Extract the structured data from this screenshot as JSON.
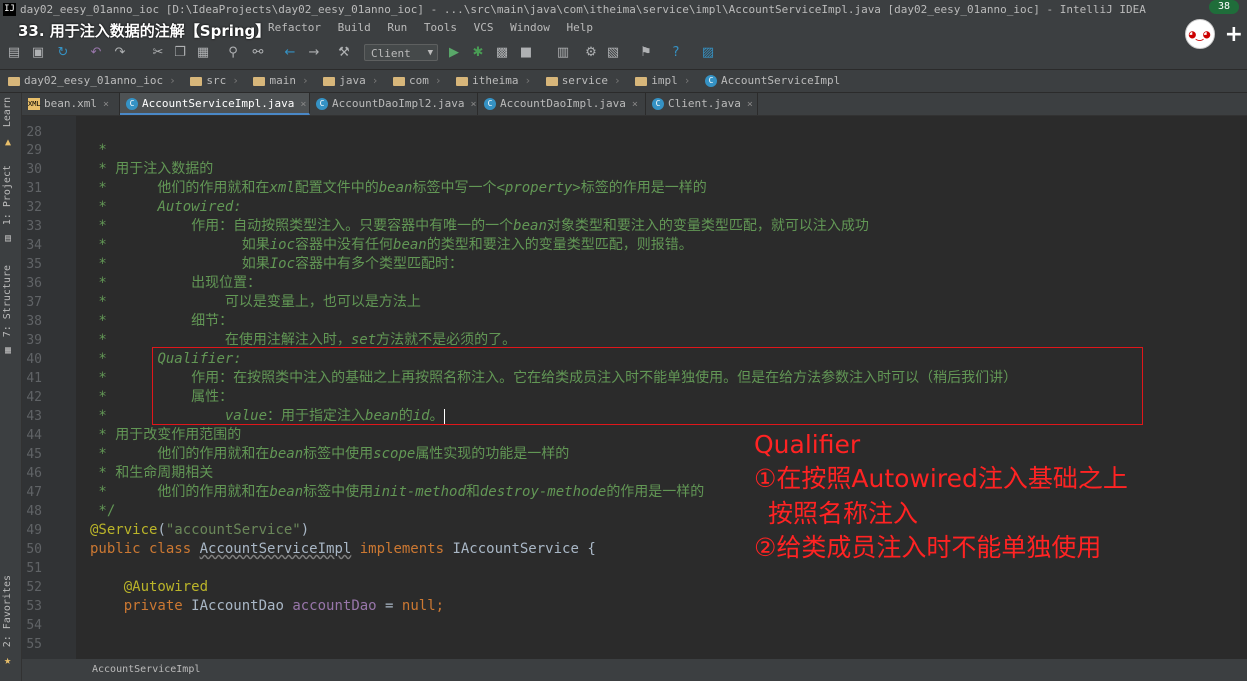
{
  "window": {
    "title": "day02_eesy_01anno_ioc [D:\\IdeaProjects\\day02_eesy_01anno_ioc] - ...\\src\\main\\java\\com\\itheima\\service\\impl\\AccountServiceImpl.java [day02_eesy_01anno_ioc] - IntelliJ IDEA"
  },
  "video_overlay": {
    "title": "33. 用于注入数据的注解【Spring】",
    "plus_label": "+",
    "counter": "38"
  },
  "menu": [
    "Refactor",
    "Build",
    "Run",
    "Tools",
    "VCS",
    "Window",
    "Help"
  ],
  "toolbar": {
    "run_config": "Client"
  },
  "breadcrumb": [
    "day02_eesy_01anno_ioc",
    "src",
    "main",
    "java",
    "com",
    "itheima",
    "service",
    "impl",
    "AccountServiceImpl"
  ],
  "tabs": [
    {
      "label": "bean.xml",
      "type": "xml",
      "active": false
    },
    {
      "label": "AccountServiceImpl.java",
      "type": "class",
      "active": true
    },
    {
      "label": "AccountDaoImpl2.java",
      "type": "class",
      "active": false
    },
    {
      "label": "AccountDaoImpl.java",
      "type": "class",
      "active": false
    },
    {
      "label": "Client.java",
      "type": "class",
      "active": false
    }
  ],
  "side_panels": [
    "1: Project",
    "2: Favorites",
    "7: Structure",
    "Learn"
  ],
  "code": {
    "line_numbers": [
      "28",
      "29",
      "30",
      "31",
      "32",
      "33",
      "34",
      "35",
      "36",
      "37",
      "38",
      "39",
      "40",
      "41",
      "42",
      "43",
      "44",
      "45",
      "46",
      "47",
      "48",
      "49",
      "50",
      "51",
      "52",
      "53",
      "54",
      "55"
    ],
    "l29": " *",
    "l30_a": " * ",
    "l30_b": "用于注入数据的",
    "l31_a": " *      他们的作用就和在",
    "l31_b": "xml",
    "l31_c": "配置文件中的",
    "l31_d": "bean",
    "l31_e": "标签中写一个",
    "l31_f": "<property>",
    "l31_g": "标签的作用是一样的",
    "l32_a": " *      ",
    "l32_b": "Autowired:",
    "l33_a": " *          作用：自动按照类型注入。只要容器中有唯一的一个",
    "l33_b": "bean",
    "l33_c": "对象类型和要注入的变量类型匹配，就可以注入成功",
    "l34_a": " *                如果",
    "l34_b": "ioc",
    "l34_c": "容器中没有任何",
    "l34_d": "bean",
    "l34_e": "的类型和要注入的变量类型匹配，则报错。",
    "l35_a": " *                如果",
    "l35_b": "Ioc",
    "l35_c": "容器中有多个类型匹配时：",
    "l36": " *          出现位置：",
    "l37": " *              可以是变量上，也可以是方法上",
    "l38": " *          细节：",
    "l39_a": " *              在使用注解注入时，",
    "l39_b": "set",
    "l39_c": "方法就不是必须的了。",
    "l40_a": " *      ",
    "l40_b": "Qualifier:",
    "l41": " *          作用：在按照类中注入的基础之上再按照名称注入。它在给类成员注入时不能单独使用。但是在给方法参数注入时可以（稍后我们讲）",
    "l42": " *          属性：",
    "l43_a": " *              ",
    "l43_b": "value",
    "l43_c": "：用于指定注入",
    "l43_d": "bean",
    "l43_e": "的",
    "l43_f": "id",
    "l43_g": "。",
    "l44": " * 用于改变作用范围的",
    "l45_a": " *      他们的作用就和在",
    "l45_b": "bean",
    "l45_c": "标签中使用",
    "l45_d": "scope",
    "l45_e": "属性实现的功能是一样的",
    "l46": " * 和生命周期相关",
    "l47_a": " *      他们的作用就和在",
    "l47_b": "bean",
    "l47_c": "标签中使用",
    "l47_d": "init-method",
    "l47_e": "和",
    "l47_f": "destroy-methode",
    "l47_g": "的作用是一样的",
    "l48": " */",
    "l49_a": "@Service",
    "l49_b": "(",
    "l49_c": "\"accountService\"",
    "l49_d": ")",
    "l50_a": "public class ",
    "l50_b": "AccountServiceImpl",
    "l50_c": " implements ",
    "l50_d": "IAccountService {",
    "l52": "    @Autowired",
    "l53_a": "    private ",
    "l53_b": "IAccountDao ",
    "l53_c": "accountDao",
    "l53_d": " = ",
    "l53_e": "null",
    "l53_f": ";"
  },
  "annotation": {
    "line1": "Qualifier",
    "line2": "①在按照Autowired注入基础之上",
    "line3": "按照名称注入",
    "line4": "②给类成员注入时不能单独使用"
  },
  "status": {
    "breadcrumb": "AccountServiceImpl"
  }
}
